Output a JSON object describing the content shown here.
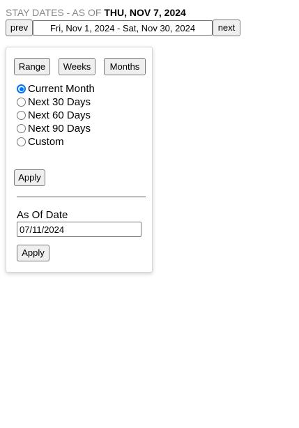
{
  "header": {
    "prefix": "STAY DATES - AS OF ",
    "date": "THU, NOV 7, 2024"
  },
  "nav": {
    "prev_label": "prev",
    "range_value": "Fri, Nov 1, 2024 - Sat, Nov 30, 2024",
    "next_label": "next"
  },
  "panel": {
    "tabs": [
      {
        "label": "Range"
      },
      {
        "label": "Weeks"
      },
      {
        "label": "Months"
      }
    ],
    "options": [
      {
        "label": "Current Month",
        "checked": true
      },
      {
        "label": "Next 30 Days",
        "checked": false
      },
      {
        "label": "Next 60 Days",
        "checked": false
      },
      {
        "label": "Next 90 Days",
        "checked": false
      },
      {
        "label": "Custom",
        "checked": false
      }
    ],
    "apply_label": "Apply",
    "as_of": {
      "label": "As Of Date",
      "value": "07/11/2024"
    },
    "as_of_apply_label": "Apply"
  },
  "colors": {
    "accent": "#0075ff",
    "muted_text": "#888888",
    "button_bg": "#efefef"
  }
}
